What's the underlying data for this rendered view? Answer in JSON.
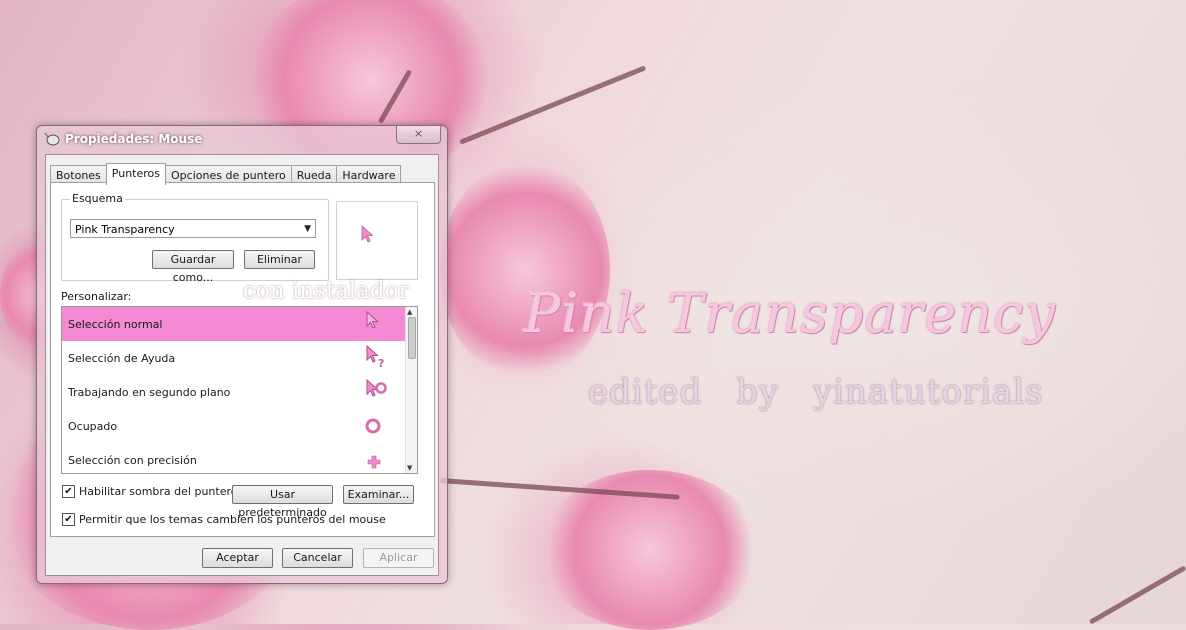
{
  "wallpaper": {
    "title": "Pink Transparency",
    "subtitle": "edited by yinatutorials",
    "installer_note": "con instalador"
  },
  "window": {
    "title": "Propiedades: Mouse",
    "close_label": "×",
    "tabs": [
      {
        "label": "Botones"
      },
      {
        "label": "Punteros"
      },
      {
        "label": "Opciones de puntero"
      },
      {
        "label": "Rueda"
      },
      {
        "label": "Hardware"
      }
    ],
    "active_tab": "Punteros",
    "scheme": {
      "group_label": "Esquema",
      "selected": "Pink Transparency",
      "save_label": "Guardar como...",
      "delete_label": "Eliminar"
    },
    "customize_label": "Personalizar:",
    "cursor_list": [
      {
        "label": "Selección normal",
        "icon": "arrow-cursor-icon",
        "selected": true
      },
      {
        "label": "Selección de Ayuda",
        "icon": "help-cursor-icon",
        "selected": false
      },
      {
        "label": "Trabajando en segundo plano",
        "icon": "background-busy-cursor-icon",
        "selected": false
      },
      {
        "label": "Ocupado",
        "icon": "busy-ring-cursor-icon",
        "selected": false
      },
      {
        "label": "Selección con precisión",
        "icon": "precision-cross-cursor-icon",
        "selected": false
      }
    ],
    "shadow_checkbox": {
      "label": "Habilitar sombra del puntero",
      "checked": true
    },
    "default_label": "Usar predeterminado",
    "browse_label": "Examinar...",
    "themes_checkbox": {
      "label": "Permitir que los temas cambien los punteros del mouse",
      "checked": true
    },
    "ok_label": "Aceptar",
    "cancel_label": "Cancelar",
    "apply_label": "Aplicar"
  },
  "colors": {
    "selection_pink": "#f48ad4",
    "cursor_pink": "#ec8fc8"
  }
}
